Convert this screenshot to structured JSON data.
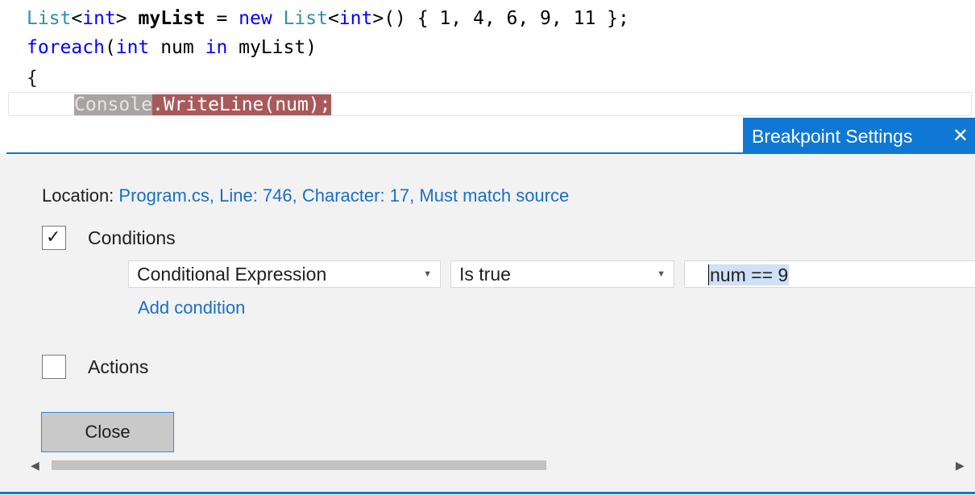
{
  "code": {
    "line1": [
      {
        "text": "List",
        "cls": "ty"
      },
      {
        "text": "<",
        "cls": "pl"
      },
      {
        "text": "int",
        "cls": "kw"
      },
      {
        "text": "> ",
        "cls": "pl"
      },
      {
        "text": "myList",
        "cls": "pl bold"
      },
      {
        "text": " = ",
        "cls": "pl"
      },
      {
        "text": "new",
        "cls": "kw"
      },
      {
        "text": " ",
        "cls": "pl"
      },
      {
        "text": "List",
        "cls": "ty"
      },
      {
        "text": "<",
        "cls": "pl"
      },
      {
        "text": "int",
        "cls": "kw"
      },
      {
        "text": ">() { 1, 4, 6, 9, 11 };",
        "cls": "pl"
      }
    ],
    "line2": [
      {
        "text": "foreach",
        "cls": "kw"
      },
      {
        "text": "(",
        "cls": "pl"
      },
      {
        "text": "int",
        "cls": "kw"
      },
      {
        "text": " num ",
        "cls": "pl"
      },
      {
        "text": "in",
        "cls": "kw"
      },
      {
        "text": " myList)",
        "cls": "pl"
      }
    ],
    "line3": "{",
    "line4_part1": "Console",
    "line4_part2": ".WriteLine(num);"
  },
  "peek": {
    "title": "Breakpoint Settings",
    "close_glyph": "✕"
  },
  "settings": {
    "location_label": "Location:",
    "location_value": "Program.cs, Line: 746, Character: 17, Must match source",
    "conditions": {
      "label": "Conditions",
      "checked": true,
      "check_glyph": "✓",
      "type_value": "Conditional Expression",
      "operator_value": "Is true",
      "expression_value": "num == 9",
      "arrow_glyph": "▼",
      "add_label": "Add condition"
    },
    "actions": {
      "label": "Actions",
      "checked": false
    },
    "close_label": "Close"
  },
  "scrollbar": {
    "left_glyph": "◀",
    "right_glyph": "▶",
    "thumb_fraction": 0.55
  },
  "colors": {
    "accent": "#0e78d4",
    "link": "#1a6fc4",
    "breakpoint_red": "#a85a5a"
  }
}
